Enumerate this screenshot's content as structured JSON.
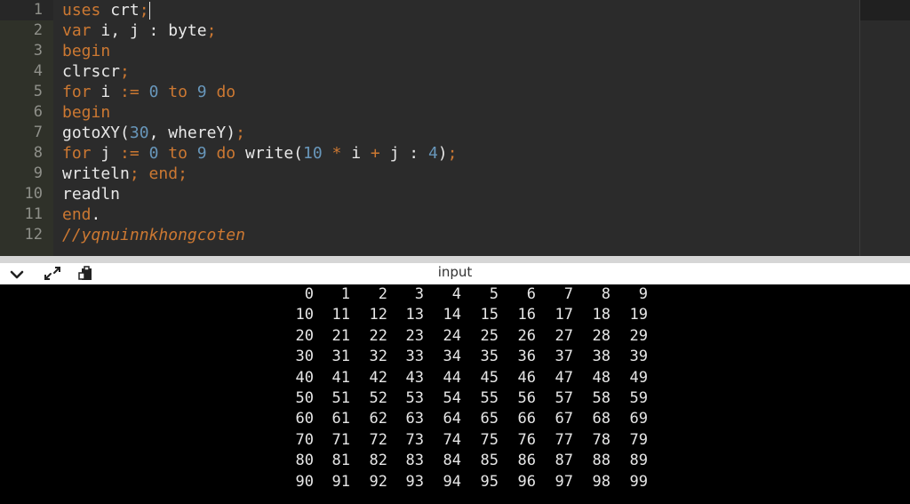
{
  "editor": {
    "lines": [
      [
        {
          "t": "uses",
          "c": "kw"
        },
        {
          "t": " ",
          "c": "id"
        },
        {
          "t": "crt",
          "c": "id"
        },
        {
          "t": ";",
          "c": "pun"
        }
      ],
      [
        {
          "t": "var",
          "c": "kw"
        },
        {
          "t": " i, j : byte",
          "c": "id"
        },
        {
          "t": ";",
          "c": "pun"
        }
      ],
      [
        {
          "t": "begin",
          "c": "kw"
        }
      ],
      [
        {
          "t": "clrscr",
          "c": "id"
        },
        {
          "t": ";",
          "c": "pun"
        }
      ],
      [
        {
          "t": "for",
          "c": "kw"
        },
        {
          "t": " i ",
          "c": "id"
        },
        {
          "t": ":=",
          "c": "op"
        },
        {
          "t": " ",
          "c": "id"
        },
        {
          "t": "0",
          "c": "num"
        },
        {
          "t": " ",
          "c": "id"
        },
        {
          "t": "to",
          "c": "kw"
        },
        {
          "t": " ",
          "c": "id"
        },
        {
          "t": "9",
          "c": "num"
        },
        {
          "t": " ",
          "c": "id"
        },
        {
          "t": "do",
          "c": "kw"
        }
      ],
      [
        {
          "t": "begin",
          "c": "kw"
        }
      ],
      [
        {
          "t": "gotoXY",
          "c": "id"
        },
        {
          "t": "(",
          "c": "id"
        },
        {
          "t": "30",
          "c": "num"
        },
        {
          "t": ", whereY)",
          "c": "id"
        },
        {
          "t": ";",
          "c": "pun"
        }
      ],
      [
        {
          "t": "for",
          "c": "kw"
        },
        {
          "t": " j ",
          "c": "id"
        },
        {
          "t": ":=",
          "c": "op"
        },
        {
          "t": " ",
          "c": "id"
        },
        {
          "t": "0",
          "c": "num"
        },
        {
          "t": " ",
          "c": "id"
        },
        {
          "t": "to",
          "c": "kw"
        },
        {
          "t": " ",
          "c": "id"
        },
        {
          "t": "9",
          "c": "num"
        },
        {
          "t": " ",
          "c": "id"
        },
        {
          "t": "do",
          "c": "kw"
        },
        {
          "t": " write(",
          "c": "id"
        },
        {
          "t": "10",
          "c": "num"
        },
        {
          "t": " ",
          "c": "id"
        },
        {
          "t": "*",
          "c": "op"
        },
        {
          "t": " i ",
          "c": "id"
        },
        {
          "t": "+",
          "c": "op"
        },
        {
          "t": " j : ",
          "c": "id"
        },
        {
          "t": "4",
          "c": "num"
        },
        {
          "t": ")",
          "c": "id"
        },
        {
          "t": ";",
          "c": "pun"
        }
      ],
      [
        {
          "t": "writeln",
          "c": "id"
        },
        {
          "t": ";",
          "c": "pun"
        },
        {
          "t": " ",
          "c": "id"
        },
        {
          "t": "end",
          "c": "kw"
        },
        {
          "t": ";",
          "c": "pun"
        }
      ],
      [
        {
          "t": "readln",
          "c": "id"
        }
      ],
      [
        {
          "t": "end",
          "c": "kw"
        },
        {
          "t": ".",
          "c": "id"
        }
      ],
      [
        {
          "t": "//yqnuinnkhongcoten",
          "c": "cmt"
        }
      ]
    ],
    "line_numbers": [
      "1",
      "2",
      "3",
      "4",
      "5",
      "6",
      "7",
      "8",
      "9",
      "10",
      "11",
      "12"
    ],
    "colors": {
      "keyword": "#cc7832",
      "number": "#6897bb",
      "identifier": "#e8e8e8",
      "background": "#2b2b2b"
    }
  },
  "toolbar": {
    "title": "input",
    "icons": [
      "chevron-down-icon",
      "expand-icon",
      "paste-icon"
    ]
  },
  "console": {
    "rows": [
      [
        "0",
        "1",
        "2",
        "3",
        "4",
        "5",
        "6",
        "7",
        "8",
        "9"
      ],
      [
        "10",
        "11",
        "12",
        "13",
        "14",
        "15",
        "16",
        "17",
        "18",
        "19"
      ],
      [
        "20",
        "21",
        "22",
        "23",
        "24",
        "25",
        "26",
        "27",
        "28",
        "29"
      ],
      [
        "30",
        "31",
        "32",
        "33",
        "34",
        "35",
        "36",
        "37",
        "38",
        "39"
      ],
      [
        "40",
        "41",
        "42",
        "43",
        "44",
        "45",
        "46",
        "47",
        "48",
        "49"
      ],
      [
        "50",
        "51",
        "52",
        "53",
        "54",
        "55",
        "56",
        "57",
        "58",
        "59"
      ],
      [
        "60",
        "61",
        "62",
        "63",
        "64",
        "65",
        "66",
        "67",
        "68",
        "69"
      ],
      [
        "70",
        "71",
        "72",
        "73",
        "74",
        "75",
        "76",
        "77",
        "78",
        "79"
      ],
      [
        "80",
        "81",
        "82",
        "83",
        "84",
        "85",
        "86",
        "87",
        "88",
        "89"
      ],
      [
        "90",
        "91",
        "92",
        "93",
        "94",
        "95",
        "96",
        "97",
        "98",
        "99"
      ]
    ]
  }
}
